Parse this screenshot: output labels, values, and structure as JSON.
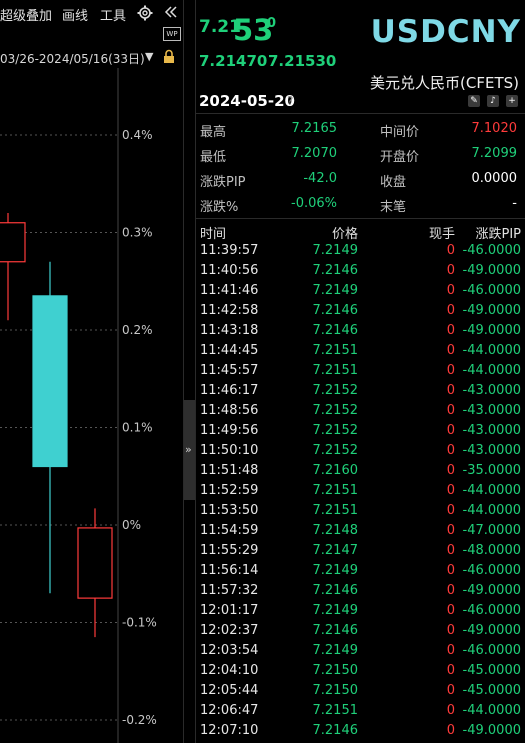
{
  "toolbar": {
    "overlay_label": "超级叠加",
    "draw_label": "画线",
    "tools_label": "工具",
    "range_text": "03/26-2024/05/16(33日)",
    "wp_badge": "WP"
  },
  "chart_data": {
    "type": "candlestick",
    "y_unit": "%",
    "y_ticks": [
      "0.4%",
      "0.3%",
      "0.2%",
      "0.1%",
      "0%",
      "-0.1%",
      "-0.2%"
    ],
    "candles": [
      {
        "open": 0.27,
        "close": 0.31,
        "high": 0.32,
        "low": 0.21,
        "color": "#ff3b3b"
      },
      {
        "open": 0.06,
        "close": 0.235,
        "high": 0.27,
        "low": -0.07,
        "color": "#3fd0d0"
      },
      {
        "open": -0.075,
        "close": -0.003,
        "high": 0.017,
        "low": -0.115,
        "color": "#ff3b3b"
      }
    ],
    "ylim": [
      -0.2,
      0.4
    ]
  },
  "quote": {
    "prefix": "7.21",
    "big": "53",
    "sup": "0",
    "bid": "7.21470",
    "ask": "7.21530",
    "symbol": "USDCNY",
    "symbol_name": "美元兑人民币(CFETS)",
    "date": "2024-05-20",
    "help_icon": "?"
  },
  "stats": [
    {
      "label": "最高",
      "value": "7.2165",
      "color": "#1fd07a"
    },
    {
      "label": "中间价",
      "value": "7.1020",
      "color": "#ff3b3b"
    },
    {
      "label": "最低",
      "value": "7.2070",
      "color": "#1fd07a"
    },
    {
      "label": "开盘价",
      "value": "7.2099",
      "color": "#1fd07a"
    },
    {
      "label": "涨跌PIP",
      "value": "-42.0",
      "color": "#1fd07a"
    },
    {
      "label": "收盘",
      "value": "0.0000",
      "color": "#ffffff"
    },
    {
      "label": "涨跌%",
      "value": "-0.06%",
      "color": "#1fd07a"
    },
    {
      "label": "末笔",
      "value": "-",
      "color": "#ffffff"
    }
  ],
  "ticks_header": {
    "time": "时间",
    "price": "价格",
    "volume": "现手",
    "pip": "涨跌PIP"
  },
  "ticks": [
    {
      "time": "11:39:57",
      "price": "7.2149",
      "volume": "0",
      "pip": "-46.0000"
    },
    {
      "time": "11:40:56",
      "price": "7.2146",
      "volume": "0",
      "pip": "-49.0000"
    },
    {
      "time": "11:41:46",
      "price": "7.2149",
      "volume": "0",
      "pip": "-46.0000"
    },
    {
      "time": "11:42:58",
      "price": "7.2146",
      "volume": "0",
      "pip": "-49.0000"
    },
    {
      "time": "11:43:18",
      "price": "7.2146",
      "volume": "0",
      "pip": "-49.0000"
    },
    {
      "time": "11:44:45",
      "price": "7.2151",
      "volume": "0",
      "pip": "-44.0000"
    },
    {
      "time": "11:45:57",
      "price": "7.2151",
      "volume": "0",
      "pip": "-44.0000"
    },
    {
      "time": "11:46:17",
      "price": "7.2152",
      "volume": "0",
      "pip": "-43.0000"
    },
    {
      "time": "11:48:56",
      "price": "7.2152",
      "volume": "0",
      "pip": "-43.0000"
    },
    {
      "time": "11:49:56",
      "price": "7.2152",
      "volume": "0",
      "pip": "-43.0000"
    },
    {
      "time": "11:50:10",
      "price": "7.2152",
      "volume": "0",
      "pip": "-43.0000"
    },
    {
      "time": "11:51:48",
      "price": "7.2160",
      "volume": "0",
      "pip": "-35.0000"
    },
    {
      "time": "11:52:59",
      "price": "7.2151",
      "volume": "0",
      "pip": "-44.0000"
    },
    {
      "time": "11:53:50",
      "price": "7.2151",
      "volume": "0",
      "pip": "-44.0000"
    },
    {
      "time": "11:54:59",
      "price": "7.2148",
      "volume": "0",
      "pip": "-47.0000"
    },
    {
      "time": "11:55:29",
      "price": "7.2147",
      "volume": "0",
      "pip": "-48.0000"
    },
    {
      "time": "11:56:14",
      "price": "7.2149",
      "volume": "0",
      "pip": "-46.0000"
    },
    {
      "time": "11:57:32",
      "price": "7.2146",
      "volume": "0",
      "pip": "-49.0000"
    },
    {
      "time": "12:01:17",
      "price": "7.2149",
      "volume": "0",
      "pip": "-46.0000"
    },
    {
      "time": "12:02:37",
      "price": "7.2146",
      "volume": "0",
      "pip": "-49.0000"
    },
    {
      "time": "12:03:54",
      "price": "7.2149",
      "volume": "0",
      "pip": "-46.0000"
    },
    {
      "time": "12:04:10",
      "price": "7.2150",
      "volume": "0",
      "pip": "-45.0000"
    },
    {
      "time": "12:05:44",
      "price": "7.2150",
      "volume": "0",
      "pip": "-45.0000"
    },
    {
      "time": "12:06:47",
      "price": "7.2151",
      "volume": "0",
      "pip": "-44.0000"
    },
    {
      "time": "12:07:10",
      "price": "7.2146",
      "volume": "0",
      "pip": "-49.0000"
    }
  ]
}
